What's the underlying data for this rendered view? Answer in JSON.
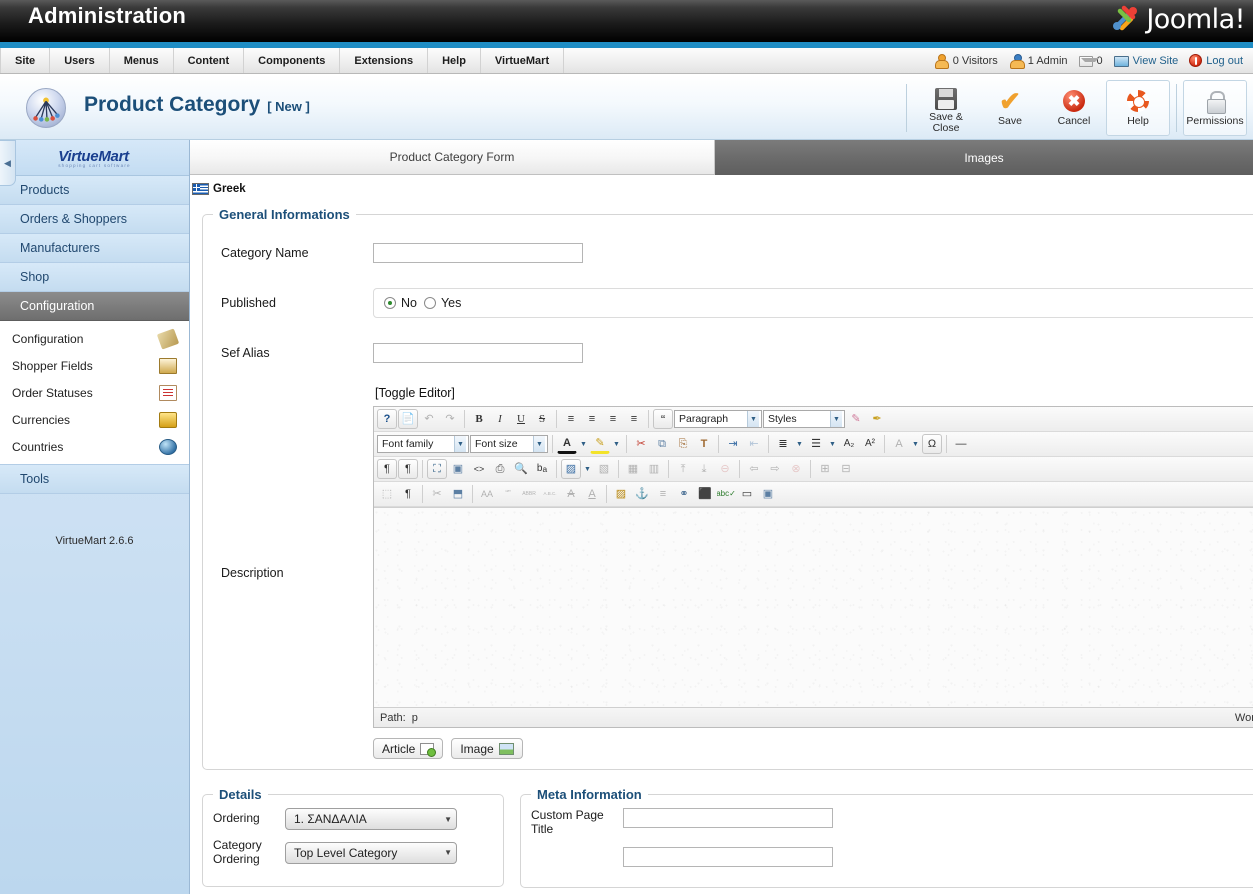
{
  "header": {
    "admin_title": "Administration",
    "brand": "Joomla!"
  },
  "menubar": {
    "items": [
      {
        "label": "Site"
      },
      {
        "label": "Users"
      },
      {
        "label": "Menus"
      },
      {
        "label": "Content"
      },
      {
        "label": "Components"
      },
      {
        "label": "Extensions"
      },
      {
        "label": "Help"
      },
      {
        "label": "VirtueMart"
      }
    ],
    "status": {
      "visitors": "0 Visitors",
      "admins": "1 Admin",
      "messages": "0",
      "view_site": "View Site",
      "logout": "Log out"
    }
  },
  "page": {
    "title": "Product Category",
    "state": "[ New ]"
  },
  "toolbar": {
    "buttons": [
      {
        "label": "Save & Close",
        "icon": "floppy-icon"
      },
      {
        "label": "Save",
        "icon": "check-icon"
      },
      {
        "label": "Cancel",
        "icon": "cancel-icon"
      },
      {
        "label": "Help",
        "icon": "lifering-icon"
      },
      {
        "label": "Permissions",
        "icon": "lock-icon"
      }
    ]
  },
  "sidebar": {
    "logo": "VirtueMart",
    "logo_sub": "shopping cart software",
    "main_items": [
      {
        "label": "Products",
        "active": false
      },
      {
        "label": "Orders & Shoppers",
        "active": false
      },
      {
        "label": "Manufacturers",
        "active": false
      },
      {
        "label": "Shop",
        "active": false
      },
      {
        "label": "Configuration",
        "active": true
      }
    ],
    "sub_items": [
      {
        "label": "Configuration",
        "icon": "wrench-icon"
      },
      {
        "label": "Shopper Fields",
        "icon": "fields-icon"
      },
      {
        "label": "Order Statuses",
        "icon": "document-icon"
      },
      {
        "label": "Currencies",
        "icon": "coins-icon"
      },
      {
        "label": "Countries",
        "icon": "globe-icon"
      }
    ],
    "tools_item": {
      "label": "Tools"
    },
    "version": "VirtueMart 2.6.6"
  },
  "tabs": [
    {
      "label": "Product Category Form",
      "active": true
    },
    {
      "label": "Images",
      "active": false
    }
  ],
  "language": {
    "label": "Greek",
    "flag": "greek-flag-icon"
  },
  "general": {
    "legend": "General Informations",
    "category_name": {
      "label": "Category Name",
      "value": "",
      "placeholder": ""
    },
    "published": {
      "label": "Published",
      "options": [
        {
          "label": "No",
          "selected": true
        },
        {
          "label": "Yes",
          "selected": false
        }
      ]
    },
    "sef_alias": {
      "label": "Sef Alias",
      "value": "",
      "placeholder": ""
    },
    "description": {
      "label": "Description",
      "toggle_editor": "[Toggle Editor]",
      "content": ""
    }
  },
  "editor": {
    "row1": [
      {
        "name": "help-icon",
        "glyph": "?"
      },
      {
        "name": "new-document-icon",
        "glyph": "□"
      },
      {
        "name": "undo-icon",
        "glyph": "↶"
      },
      {
        "name": "redo-icon",
        "glyph": "↷"
      },
      {
        "name": "bold-icon",
        "glyph": "B"
      },
      {
        "name": "italic-icon",
        "glyph": "I"
      },
      {
        "name": "underline-icon",
        "glyph": "U"
      },
      {
        "name": "strikethrough-icon",
        "glyph": "S"
      },
      {
        "name": "align-left-icon",
        "glyph": "≡"
      },
      {
        "name": "align-center-icon",
        "glyph": "≡"
      },
      {
        "name": "align-right-icon",
        "glyph": "≡"
      },
      {
        "name": "align-justify-icon",
        "glyph": "≡"
      },
      {
        "name": "blockquote-icon",
        "glyph": "“"
      }
    ],
    "paragraph_select": "Paragraph",
    "styles_select": "Styles",
    "row1_tail": [
      {
        "name": "remove-format-icon",
        "glyph": "✐"
      },
      {
        "name": "cleanup-icon",
        "glyph": "✂"
      }
    ],
    "font_family_select": "Font family",
    "font_size_select": "Font size",
    "row2": [
      {
        "name": "text-color-icon",
        "glyph": "A"
      },
      {
        "name": "highlight-color-icon",
        "glyph": "✎"
      },
      {
        "name": "cut-icon",
        "glyph": "✂"
      },
      {
        "name": "copy-icon",
        "glyph": "⧉"
      },
      {
        "name": "paste-icon",
        "glyph": "⎘"
      },
      {
        "name": "paste-text-icon",
        "glyph": "T"
      },
      {
        "name": "indent-icon",
        "glyph": "⇥"
      },
      {
        "name": "outdent-icon",
        "glyph": "⇤"
      },
      {
        "name": "numbered-list-icon",
        "glyph": "≣"
      },
      {
        "name": "bullet-list-icon",
        "glyph": "☰"
      },
      {
        "name": "subscript-icon",
        "glyph": "A₂"
      },
      {
        "name": "superscript-icon",
        "glyph": "A²"
      },
      {
        "name": "spellcheck-icon",
        "glyph": "A"
      },
      {
        "name": "special-char-icon",
        "glyph": "Ω"
      },
      {
        "name": "horizontal-rule-icon",
        "glyph": "—"
      }
    ],
    "row3": [
      {
        "name": "ltr-icon",
        "glyph": "¶"
      },
      {
        "name": "rtl-icon",
        "glyph": "¶"
      },
      {
        "name": "fullscreen-icon",
        "glyph": "⛶"
      },
      {
        "name": "preview-icon",
        "glyph": "▣"
      },
      {
        "name": "source-code-icon",
        "glyph": "<>"
      },
      {
        "name": "print-icon",
        "glyph": "⎙"
      },
      {
        "name": "search-icon",
        "glyph": "⚲"
      },
      {
        "name": "replace-icon",
        "glyph": "ba"
      },
      {
        "name": "insert-template-icon",
        "glyph": "▤"
      },
      {
        "name": "template-options-icon",
        "glyph": "▾"
      },
      {
        "name": "delete-template-icon",
        "glyph": "▧"
      },
      {
        "name": "table-props-icon",
        "glyph": "▦"
      },
      {
        "name": "cell-props-icon",
        "glyph": "▥"
      },
      {
        "name": "insert-row-before-icon",
        "glyph": "⤒"
      },
      {
        "name": "insert-row-after-icon",
        "glyph": "⤓"
      },
      {
        "name": "delete-row-icon",
        "glyph": "⊖"
      },
      {
        "name": "insert-col-before-icon",
        "glyph": "⇦"
      },
      {
        "name": "insert-col-after-icon",
        "glyph": "⇨"
      },
      {
        "name": "delete-col-icon",
        "glyph": "⊗"
      },
      {
        "name": "split-cells-icon",
        "glyph": "⊞"
      },
      {
        "name": "merge-cells-icon",
        "glyph": "⊟"
      }
    ],
    "row4": [
      {
        "name": "visual-aid-icon",
        "glyph": "⬚"
      },
      {
        "name": "show-blocks-icon",
        "glyph": "¶"
      },
      {
        "name": "page-break-icon",
        "glyph": "✂"
      },
      {
        "name": "insert-layer-icon",
        "glyph": "⬒"
      },
      {
        "name": "styleprops-icon",
        "glyph": "AA"
      },
      {
        "name": "citation-icon",
        "glyph": "“”"
      },
      {
        "name": "abbreviation-icon",
        "glyph": "ABBR"
      },
      {
        "name": "acronym-icon",
        "glyph": "A.B.C."
      },
      {
        "name": "delete-text-icon",
        "glyph": "A"
      },
      {
        "name": "insert-text-icon",
        "glyph": "A"
      },
      {
        "name": "insert-date-icon",
        "glyph": "▤"
      },
      {
        "name": "anchor-icon",
        "glyph": "⚓"
      },
      {
        "name": "nonbreaking-icon",
        "glyph": "≡"
      },
      {
        "name": "insert-link-icon",
        "glyph": "⚭"
      },
      {
        "name": "insert-image-icon",
        "glyph": "⬛"
      },
      {
        "name": "spellchecker-icon",
        "glyph": "abc"
      },
      {
        "name": "insert-media-icon",
        "glyph": "▭"
      },
      {
        "name": "readmore-icon",
        "glyph": "▣"
      }
    ],
    "status": {
      "path_label": "Path:",
      "path_value": "p",
      "word_label": "Word"
    },
    "extra_buttons": [
      {
        "label": "Article",
        "icon": "article-icon"
      },
      {
        "label": "Image",
        "icon": "image-icon"
      }
    ]
  },
  "details": {
    "legend": "Details",
    "rows": [
      {
        "label": "Ordering",
        "value": "1. ΣΑΝΔΑΛΙΑ"
      },
      {
        "label": "Category Ordering",
        "value": "Top Level Category"
      }
    ]
  },
  "meta": {
    "legend": "Meta Information",
    "rows": [
      {
        "label": "Custom Page Title",
        "value": ""
      },
      {
        "label": "",
        "value": ""
      }
    ]
  }
}
